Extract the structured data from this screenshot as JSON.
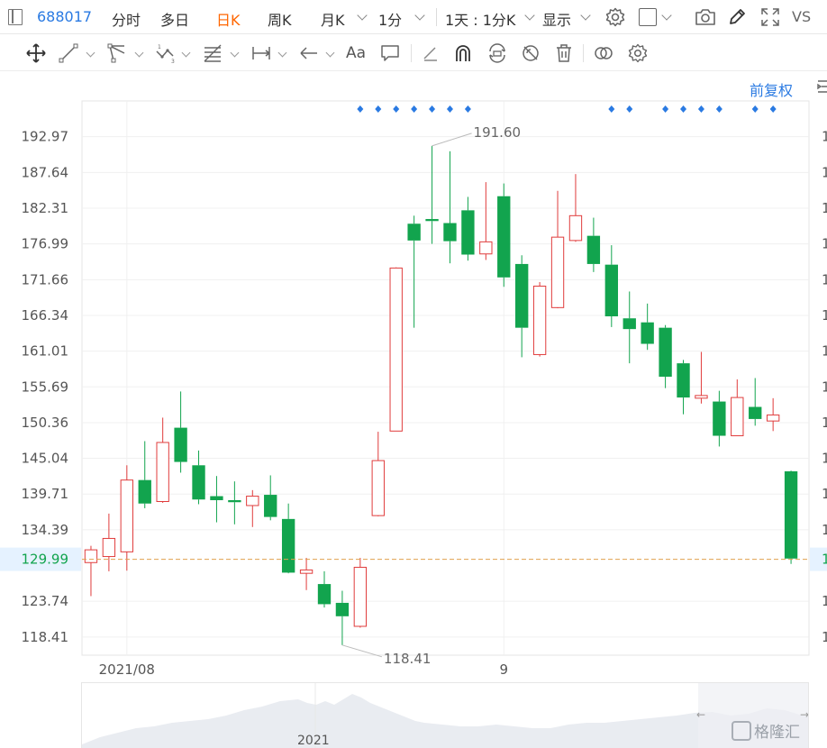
{
  "toolbar": {
    "stock_code": "688017",
    "periods": [
      "分时",
      "多日",
      "日K",
      "周K",
      "月K",
      "1分"
    ],
    "active_period": "日K",
    "range_select": "1天 : 1分K",
    "display_label": "显示",
    "vs_label": "VS"
  },
  "draw_tools": {
    "font_tool_label": "Aa"
  },
  "chart": {
    "adjust_label": "前复权",
    "y_ticks": [
      "192.97",
      "187.64",
      "182.31",
      "176.99",
      "171.66",
      "166.34",
      "161.01",
      "155.69",
      "150.36",
      "145.04",
      "139.71",
      "134.39",
      "129.99",
      "123.74",
      "118.41"
    ],
    "right_tick_digit": "1",
    "current_price_label": "129.99",
    "max_label": "191.60",
    "min_label": "118.41",
    "x_labels": [
      "2021/08",
      "9"
    ],
    "colors": {
      "up": "#e03c3c",
      "down": "#12a44e",
      "price_line": "#e0a04e",
      "current_bg": "#e5f2ff",
      "marker": "#2a7ae2"
    }
  },
  "chart_data": {
    "type": "candlestick",
    "y_range": [
      115.7,
      198.3
    ],
    "series": [
      {
        "o": 129.5,
        "h": 132.0,
        "l": 124.5,
        "c": 131.4
      },
      {
        "o": 130.4,
        "h": 136.8,
        "l": 128.2,
        "c": 133.1
      },
      {
        "o": 131.1,
        "h": 144.0,
        "l": 128.3,
        "c": 141.8
      },
      {
        "o": 141.8,
        "h": 147.6,
        "l": 137.6,
        "c": 138.3
      },
      {
        "o": 138.6,
        "h": 151.1,
        "l": 138.4,
        "c": 147.4
      },
      {
        "o": 149.6,
        "h": 155.0,
        "l": 142.9,
        "c": 144.5
      },
      {
        "o": 144.0,
        "h": 146.2,
        "l": 138.2,
        "c": 138.9
      },
      {
        "o": 139.4,
        "h": 142.4,
        "l": 135.5,
        "c": 138.8
      },
      {
        "o": 138.8,
        "h": 141.6,
        "l": 135.2,
        "c": 138.5
      },
      {
        "o": 138.0,
        "h": 140.3,
        "l": 134.8,
        "c": 139.4
      },
      {
        "o": 139.6,
        "h": 142.5,
        "l": 135.8,
        "c": 136.3
      },
      {
        "o": 136.0,
        "h": 138.3,
        "l": 127.9,
        "c": 128.0
      },
      {
        "o": 127.9,
        "h": 130.2,
        "l": 125.4,
        "c": 128.4
      },
      {
        "o": 126.3,
        "h": 128.2,
        "l": 122.8,
        "c": 123.3
      },
      {
        "o": 123.5,
        "h": 125.3,
        "l": 117.2,
        "c": 121.5
      },
      {
        "o": 120.0,
        "h": 130.2,
        "l": 119.8,
        "c": 128.8
      },
      {
        "o": 136.5,
        "h": 149.0,
        "l": 136.4,
        "c": 144.7
      },
      {
        "o": 149.1,
        "h": 173.5,
        "l": 149.1,
        "c": 173.4
      },
      {
        "o": 180.0,
        "h": 181.2,
        "l": 164.5,
        "c": 177.5
      },
      {
        "o": 180.7,
        "h": 191.6,
        "l": 177.0,
        "c": 180.4
      },
      {
        "o": 180.1,
        "h": 190.8,
        "l": 174.1,
        "c": 177.4
      },
      {
        "o": 182.0,
        "h": 184.0,
        "l": 174.5,
        "c": 175.4
      },
      {
        "o": 175.5,
        "h": 186.2,
        "l": 174.6,
        "c": 177.3
      },
      {
        "o": 184.1,
        "h": 186.0,
        "l": 170.6,
        "c": 172.0
      },
      {
        "o": 174.0,
        "h": 175.3,
        "l": 160.1,
        "c": 164.5
      },
      {
        "o": 160.5,
        "h": 171.3,
        "l": 160.2,
        "c": 170.7
      },
      {
        "o": 167.5,
        "h": 184.9,
        "l": 167.4,
        "c": 178.0
      },
      {
        "o": 177.5,
        "h": 187.4,
        "l": 177.3,
        "c": 181.2
      },
      {
        "o": 178.2,
        "h": 180.9,
        "l": 172.8,
        "c": 174.0
      },
      {
        "o": 173.9,
        "h": 176.8,
        "l": 164.6,
        "c": 166.2
      },
      {
        "o": 165.9,
        "h": 169.9,
        "l": 159.2,
        "c": 164.3
      },
      {
        "o": 165.3,
        "h": 168.1,
        "l": 161.2,
        "c": 162.1
      },
      {
        "o": 164.5,
        "h": 164.9,
        "l": 155.5,
        "c": 157.2
      },
      {
        "o": 159.2,
        "h": 159.7,
        "l": 151.6,
        "c": 154.1
      },
      {
        "o": 154.0,
        "h": 160.9,
        "l": 153.2,
        "c": 154.4
      },
      {
        "o": 153.5,
        "h": 155.1,
        "l": 146.8,
        "c": 148.4
      },
      {
        "o": 148.4,
        "h": 156.8,
        "l": 148.4,
        "c": 154.1
      },
      {
        "o": 152.7,
        "h": 157.0,
        "l": 149.9,
        "c": 150.9
      },
      {
        "o": 150.6,
        "h": 154.0,
        "l": 149.1,
        "c": 151.5
      },
      {
        "o": 143.1,
        "h": 143.2,
        "l": 129.3,
        "c": 130.1
      }
    ]
  },
  "navigator": {
    "year_label": "2021"
  },
  "watermark": {
    "text": "格隆汇"
  }
}
